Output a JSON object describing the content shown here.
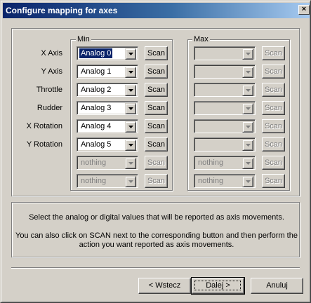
{
  "window": {
    "title": "Configure mapping for axes",
    "close_glyph": "×"
  },
  "groups": {
    "min_title": "Min",
    "max_title": "Max"
  },
  "rows": [
    {
      "label": "X Axis",
      "min_value": "Analog 0",
      "min_enabled": true,
      "min_selected": true,
      "max_value": "",
      "max_enabled": false
    },
    {
      "label": "Y Axis",
      "min_value": "Analog 1",
      "min_enabled": true,
      "min_selected": false,
      "max_value": "",
      "max_enabled": false
    },
    {
      "label": "Throttle",
      "min_value": "Analog 2",
      "min_enabled": true,
      "min_selected": false,
      "max_value": "",
      "max_enabled": false
    },
    {
      "label": "Rudder",
      "min_value": "Analog 3",
      "min_enabled": true,
      "min_selected": false,
      "max_value": "",
      "max_enabled": false
    },
    {
      "label": "X Rotation",
      "min_value": "Analog 4",
      "min_enabled": true,
      "min_selected": false,
      "max_value": "",
      "max_enabled": false
    },
    {
      "label": "Y Rotation",
      "min_value": "Analog 5",
      "min_enabled": true,
      "min_selected": false,
      "max_value": "",
      "max_enabled": false
    },
    {
      "label": "",
      "min_value": "nothing",
      "min_enabled": false,
      "min_selected": false,
      "max_value": "nothing",
      "max_enabled": false
    },
    {
      "label": "",
      "min_value": "nothing",
      "min_enabled": false,
      "min_selected": false,
      "max_value": "nothing",
      "max_enabled": false
    }
  ],
  "scan_label": "Scan",
  "info": {
    "line1": "Select the analog or digital values that will be reported as axis movements.",
    "line2": "You can also click on SCAN next to the corresponding button and then perform the",
    "line3": "action you want reported as axis movements."
  },
  "buttons": {
    "back": "< Wstecz",
    "next": "Dalej >",
    "cancel": "Anuluj"
  },
  "colors": {
    "title_start": "#0a246a",
    "title_end": "#a6caf0",
    "face": "#d4d0c8",
    "selection": "#0a246a"
  }
}
